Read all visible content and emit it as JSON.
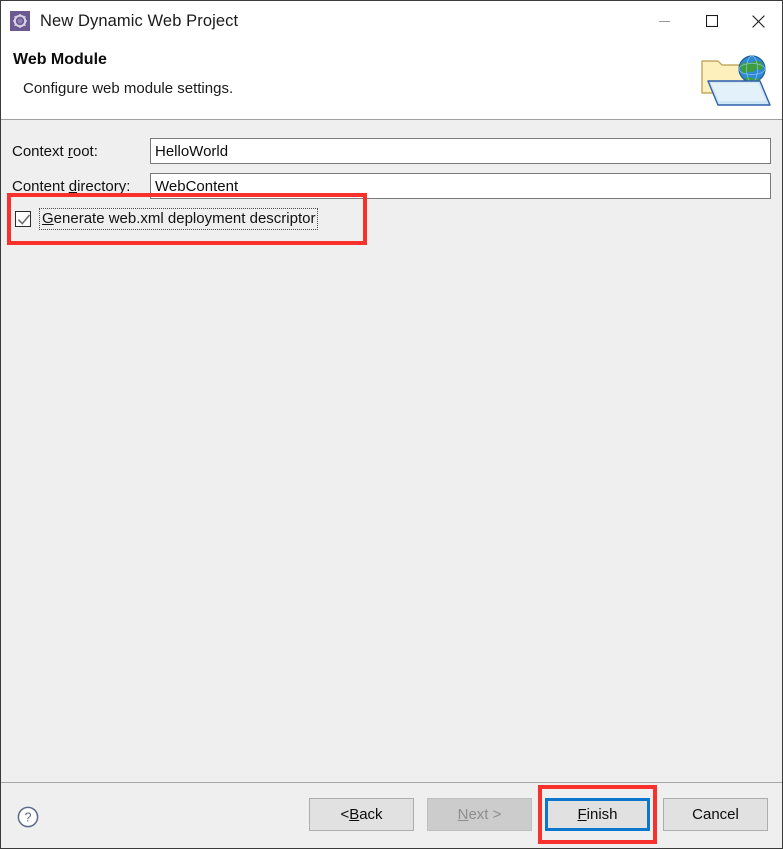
{
  "window": {
    "title": "New Dynamic Web Project",
    "icon": "eclipse-new-wizard-icon",
    "controls": {
      "minimize": "minimize-icon",
      "maximize": "maximize-icon",
      "close": "close-icon"
    }
  },
  "header": {
    "title": "Web Module",
    "description": "Configure web module settings.",
    "banner_icon": "web-folder-globe-icon"
  },
  "form": {
    "fields": [
      {
        "label_before": "Context ",
        "label_mnemonic": "r",
        "label_after": "oot:",
        "value": "HelloWorld",
        "placeholder": ""
      },
      {
        "label_before": "Content ",
        "label_mnemonic": "d",
        "label_after": "irectory:",
        "value": "WebContent",
        "placeholder": ""
      }
    ],
    "checkbox": {
      "checked": true,
      "label_before": "",
      "label_mnemonic": "G",
      "label_after": "enerate web.xml deployment descriptor",
      "focused": true,
      "highlighted": true
    }
  },
  "footer": {
    "help_icon": "help-question-icon",
    "buttons": [
      {
        "name": "back-button",
        "label_before": "< ",
        "label_mnemonic": "B",
        "label_after": "ack",
        "state": "enabled",
        "highlighted": false
      },
      {
        "name": "next-button",
        "label_before": "",
        "label_mnemonic": "N",
        "label_after": "ext >",
        "state": "disabled",
        "highlighted": false
      },
      {
        "name": "finish-button",
        "label_before": "",
        "label_mnemonic": "F",
        "label_after": "inish",
        "state": "default",
        "highlighted": true
      },
      {
        "name": "cancel-button",
        "label_before": "Cancel",
        "label_mnemonic": "",
        "label_after": "",
        "state": "enabled",
        "highlighted": false
      }
    ]
  },
  "colors": {
    "annotation_red": "#f8312d",
    "focus_blue": "#0a76cd",
    "dialog_background": "#efefef",
    "header_background": "#ffffff",
    "button_face": "#e1e1e1",
    "disabled_face": "#cccccc"
  }
}
